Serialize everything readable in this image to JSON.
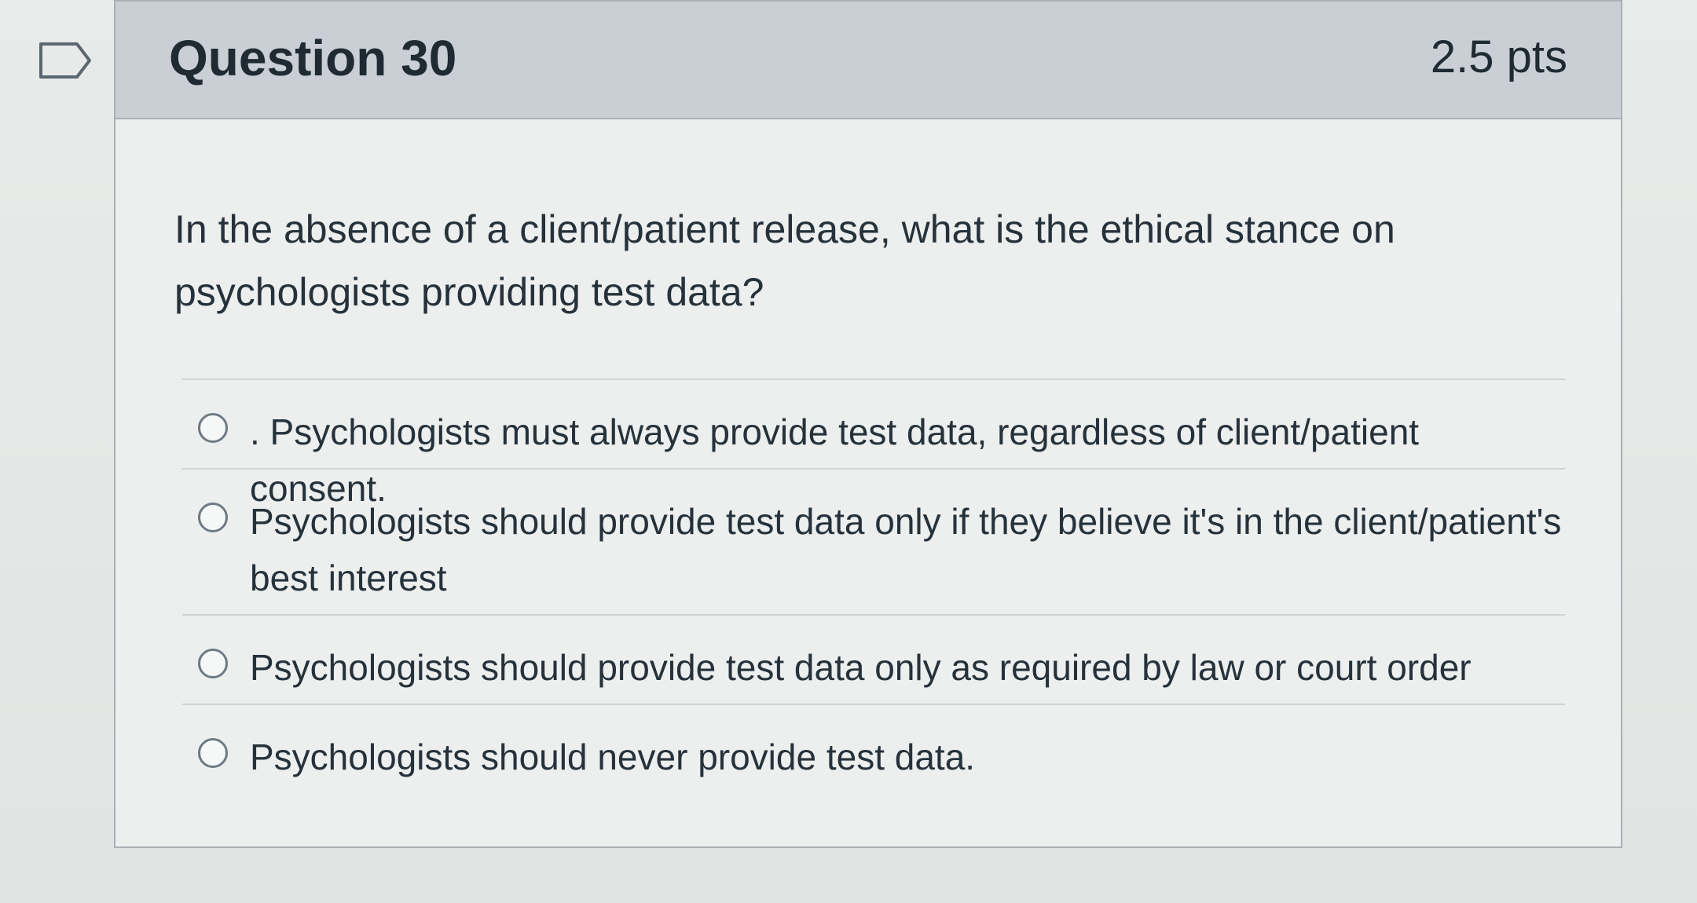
{
  "question": {
    "title": "Question 30",
    "points": "2.5 pts",
    "flag_icon": "flag-outline-icon",
    "text": "In the absence of a client/patient release, what is the ethical stance on psychologists providing test data?"
  },
  "answers": [
    {
      "label": ". Psychologists must always provide test data, regardless of client/patient consent."
    },
    {
      "label": "Psychologists should provide test data only if they believe it's in the client/patient's best interest"
    },
    {
      "label": "Psychologists should provide test data only as required by law or court order"
    },
    {
      "label": "Psychologists should never provide test data."
    }
  ],
  "colors": {
    "header_bg": "#c9cfd4",
    "card_bg": "#edefee",
    "text": "#26323b"
  }
}
